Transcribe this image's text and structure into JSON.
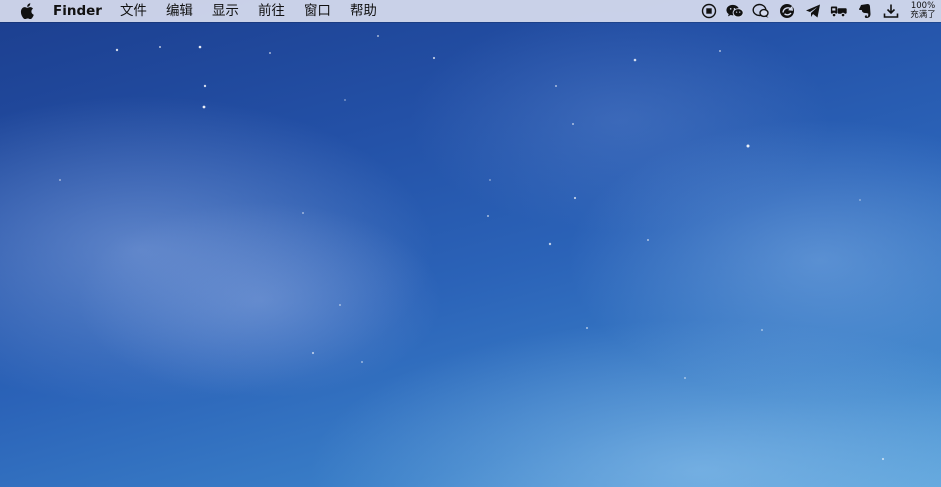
{
  "menubar": {
    "apple_icon": "apple-logo-icon",
    "app_name": "Finder",
    "menus": [
      "文件",
      "编辑",
      "显示",
      "前往",
      "窗口",
      "帮助"
    ]
  },
  "status_items": [
    "screen-record-stop-icon",
    "wechat-icon",
    "chat-bubble-icon",
    "browser-sync-icon",
    "telegram-icon",
    "delivery-truck-icon",
    "evernote-icon",
    "download-icon"
  ],
  "battery": {
    "percent": "100%",
    "status": "充满了"
  },
  "colors": {
    "menubar_bg": "#d6dcee",
    "desktop_top": "#1c3e8e",
    "desktop_bottom": "#5aa2da"
  }
}
